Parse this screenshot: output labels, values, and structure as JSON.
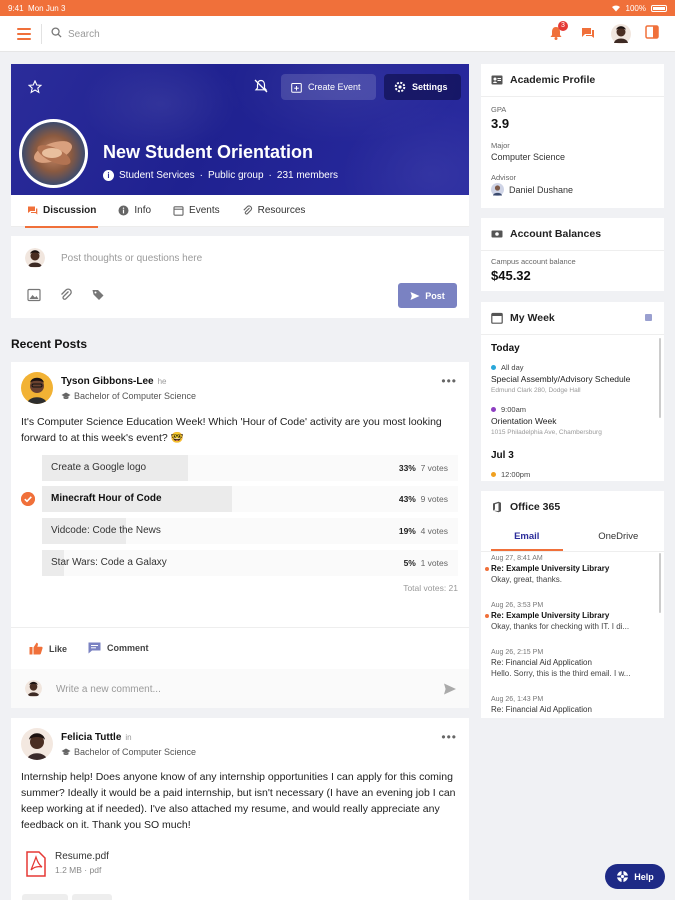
{
  "status_bar": {
    "time": "9:41",
    "date": "Mon Jun 3",
    "battery": "100%"
  },
  "topbar": {
    "search_placeholder": "Search",
    "notification_count": "3"
  },
  "group": {
    "title": "New Student Orientation",
    "department": "Student Services",
    "visibility": "Public group",
    "members": "231 members",
    "create_event_label": "Create Event",
    "settings_label": "Settings"
  },
  "tabs": [
    {
      "label": "Discussion",
      "active": true
    },
    {
      "label": "Info"
    },
    {
      "label": "Events"
    },
    {
      "label": "Resources"
    }
  ],
  "composer": {
    "placeholder": "Post thoughts or questions here",
    "post_label": "Post"
  },
  "recent_posts_title": "Recent Posts",
  "posts": [
    {
      "author": "Tyson Gibbons-Lee",
      "tag": "he",
      "program": "Bachelor of Computer Science",
      "body": "It's Computer Science Education Week! Which 'Hour of Code' activity are you most looking forward to at this week's event? 🤓",
      "poll": [
        {
          "option": "Create a Google logo",
          "percent": "33%",
          "votes": "7 votes",
          "fraction": 0.33
        },
        {
          "option": "Minecraft Hour of Code",
          "percent": "43%",
          "votes": "9 votes",
          "fraction": 0.43,
          "chosen": true
        },
        {
          "option": "Vidcode: Code the News",
          "percent": "19%",
          "votes": "4 votes",
          "fraction": 0.19
        },
        {
          "option": "Star Wars: Code a Galaxy",
          "percent": "5%",
          "votes": "1 votes",
          "fraction": 0.05
        }
      ],
      "total_votes": "Total votes: 21",
      "like_label": "Like",
      "comment_label": "Comment",
      "comment_placeholder": "Write a new comment..."
    },
    {
      "author": "Felicia Tuttle",
      "tag": "in",
      "program": "Bachelor of Computer Science",
      "body": "Internship help! Does anyone know of any internship opportunities I can apply for this coming summer? Ideally it would be a paid internship, but isn't necessary (I have an evening job I can keep working at if needed). I've also attached my resume, and would really appreciate any feedback on it. Thank you SO much!",
      "attachment": {
        "name": "Resume.pdf",
        "size": "1.2 MB",
        "type": "pdf"
      }
    }
  ],
  "academic_profile": {
    "title": "Academic Profile",
    "gpa_label": "GPA",
    "gpa": "3.9",
    "major_label": "Major",
    "major": "Computer Science",
    "advisor_label": "Advisor",
    "advisor": "Daniel Dushane"
  },
  "account_balances": {
    "title": "Account Balances",
    "label": "Campus account balance",
    "amount": "$45.32"
  },
  "my_week": {
    "title": "My Week",
    "days": [
      {
        "day": "Today",
        "events": [
          {
            "time": "All day",
            "title": "Special Assembly/Advisory Schedule",
            "location": "Edmund Clark 280, Dodge Hall",
            "color": "#29a7d9"
          },
          {
            "time": "9:00am",
            "title": "Orientation Week",
            "location": "1015 Philadelphia Ave, Chambersburg",
            "color": "#8e3fc2"
          }
        ]
      },
      {
        "day": "Jul 3",
        "events": [
          {
            "time": "12:00pm",
            "color": "#f0a020"
          }
        ]
      }
    ]
  },
  "office365": {
    "title": "Office 365",
    "tabs": [
      "Email",
      "OneDrive"
    ],
    "emails": [
      {
        "date": "Aug 27, 8:41 AM",
        "subject": "Re: Example University Library",
        "preview": "Okay, great, thanks.",
        "unread": true
      },
      {
        "date": "Aug 26, 3:53 PM",
        "subject": "Re: Example University Library",
        "preview": "Okay, thanks for checking with IT. I di...",
        "unread": true
      },
      {
        "date": "Aug 26, 2:15 PM",
        "subject": "Re: Financial Aid Application",
        "preview": "Hello. Sorry, this is the third email. I w...",
        "unread": false
      },
      {
        "date": "Aug 26, 1:43 PM",
        "subject": "Re: Financial Aid Application",
        "preview": "",
        "unread": false
      }
    ]
  },
  "help_label": "Help",
  "colors": {
    "accent": "#f0703a",
    "brand": "#2b2c9a",
    "help": "#1e2a86"
  }
}
